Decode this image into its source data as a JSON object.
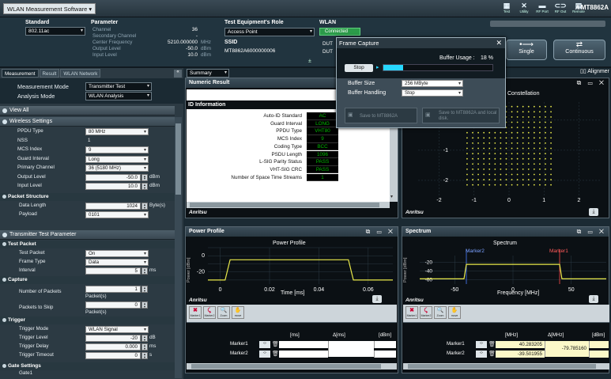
{
  "titlebar": {
    "app_name": "WLAN Measurement Software",
    "icons": [
      {
        "name": "test-icon",
        "label": "Test"
      },
      {
        "name": "utility-icon",
        "label": "Utility"
      },
      {
        "name": "rf-port-icon",
        "label": "RF Port"
      },
      {
        "name": "rf-out-icon",
        "label": "RF Out"
      },
      {
        "name": "remote-icon",
        "label": "Remote"
      }
    ],
    "brand": "MT8862A"
  },
  "top": {
    "standard_label": "Standard",
    "standard_value": "802.11ac",
    "parameter_label": "Parameter",
    "channel_label": "Channel",
    "channel_value": "36",
    "secondary_channel_label": "Secondary Channel",
    "secondary_channel_value": "-",
    "center_freq_label": "Center Frequency",
    "center_freq_value": "5210.000000",
    "center_freq_unit": "MHz",
    "output_level_label": "Output Level",
    "output_level_value": "-50.0",
    "output_level_unit": "dBm",
    "input_level_label": "Input Level",
    "input_level_value": "10.0",
    "input_level_unit": "dBm",
    "role_label": "Test Equipment's Role",
    "role_value": "Access Point",
    "ssid_label": "SSID",
    "ssid_value": "MT8862A6000000006",
    "wlan_label": "WLAN",
    "wlan_status": "Connected",
    "dut_label_1": "DUT",
    "dut_label_2": "DUT",
    "single_label": "Single",
    "continuous_label": "Continuous",
    "alignment_label": "Alignmer"
  },
  "left": {
    "tabs": [
      "Measurement",
      "Result",
      "WLAN Network"
    ],
    "measurement_mode_label": "Measurement Mode",
    "measurement_mode_value": "Transmitter Test",
    "analysis_mode_label": "Analysis Mode",
    "analysis_mode_value": "WLAN Analysis",
    "view_all": "View All",
    "wireless_settings": "Wireless Settings",
    "wireless_rows": [
      {
        "label": "PPDU Type",
        "value": "80 MHz",
        "type": "dd"
      },
      {
        "label": "NSS",
        "value": "1",
        "type": "text"
      },
      {
        "label": "MCS Index",
        "value": "9",
        "type": "dd"
      },
      {
        "label": "Guard Interval",
        "value": "Long",
        "type": "dd"
      },
      {
        "label": "Primary Channel",
        "value": "36 (5180 MHz)",
        "type": "dd"
      },
      {
        "label": "Output Level",
        "value": "-50.0",
        "unit": "dBm",
        "type": "num"
      },
      {
        "label": "Input Level",
        "value": "10.0",
        "unit": "dBm",
        "type": "num"
      }
    ],
    "packet_structure": "Packet Structure",
    "data_length_label": "Data Length",
    "data_length_value": "1024",
    "data_length_unit": "Byte(s)",
    "payload_label": "Payload",
    "payload_value": "0101",
    "tx_param": "Transmitter Test Parameter",
    "test_packet": "Test Packet",
    "test_packet_rows": [
      {
        "label": "Test Packet",
        "value": "On"
      },
      {
        "label": "Frame Type",
        "value": "Data"
      }
    ],
    "interval_label": "Interval",
    "interval_value": "5",
    "interval_unit": "ms",
    "capture": "Capture",
    "num_packets_label": "Number of Packets",
    "num_packets_value": "1",
    "num_packets_unit": "Packet(s)",
    "skip_label": "Packets to Skip",
    "skip_value": "0",
    "skip_unit": "Packet(s)",
    "trigger": "Trigger",
    "trigger_mode_label": "Trigger Mode",
    "trigger_mode_value": "WLAN Signal",
    "trigger_level_label": "Trigger Level",
    "trigger_level_value": "-20",
    "trigger_level_unit": "dB",
    "trigger_delay_label": "Trigger Delay",
    "trigger_delay_value": "0.000",
    "trigger_delay_unit": "ms",
    "trigger_timeout_label": "Trigger Timeout",
    "trigger_timeout_value": "0",
    "trigger_timeout_unit": "s",
    "gate_settings": "Gate Settings",
    "gate1": "Gate1"
  },
  "summary": {
    "label": "Summary"
  },
  "numeric": {
    "title": "Numeric Result",
    "section": "ID Information",
    "rows": [
      {
        "label": "Auto-ID Standard",
        "value": "AC"
      },
      {
        "label": "Guard Interval",
        "value": "LONG"
      },
      {
        "label": "PPDU Type",
        "value": "VHT80"
      },
      {
        "label": "MCS Index",
        "value": "9"
      },
      {
        "label": "Coding Type",
        "value": "BCC"
      },
      {
        "label": "PSDU Length",
        "value": "1096"
      },
      {
        "label": "L-SIG Parity Status",
        "value": "PASS"
      },
      {
        "label": "VHT-SIG CRC",
        "value": "PASS"
      },
      {
        "label": "Number of Space Time Streams",
        "value": "1"
      }
    ],
    "brand": "Anritsu"
  },
  "dialog": {
    "title": "Frame Capture",
    "stop_label": "Stop",
    "buffer_usage_label": "Buffer Usage :",
    "buffer_usage_value": "18 %",
    "buffer_fill": 0.18,
    "buffer_size_label": "Buffer Size",
    "buffer_size_value": "256 MByte",
    "buffer_handling_label": "Buffer Handling",
    "buffer_handling_value": "Stop",
    "save_to_label": "Save to MT8862A",
    "save_local_label": "Save to MT8862A and local disk."
  },
  "constellation": {
    "title": "Constellation",
    "brand": "Anritsu",
    "yticks": [
      "0",
      "-1",
      "-2"
    ],
    "xticks": [
      "-2",
      "-1",
      "0",
      "1",
      "2"
    ]
  },
  "power_profile": {
    "title": "Power Profile",
    "chart_title": "Power Profile",
    "ylabel": "Power [dBm]",
    "xlabel": "Time [ms]",
    "yticks": [
      "0",
      "-20"
    ],
    "xticks": [
      "0",
      "0.02",
      "0.04",
      "0.06"
    ],
    "brand": "Anritsu",
    "tools": [
      "Marker1",
      "Marker2",
      "Zoom",
      "move"
    ],
    "table_headers": [
      "[ms]",
      "Δ[ms]",
      "[dBm]"
    ],
    "markers": [
      "Marker1",
      "Marker2"
    ]
  },
  "spectrum": {
    "title": "Spectrum",
    "chart_title": "Spectrum",
    "ylabel": "Power [dBm]",
    "xlabel": "Frequency [MHz]",
    "yticks": [
      "-20",
      "-40",
      "-60"
    ],
    "xticks": [
      "-50",
      "0",
      "50"
    ],
    "marker2_label": "Marker2",
    "marker1_label": "Marker1",
    "brand": "Anritsu",
    "tools": [
      "Marker1",
      "Marker2",
      "Zoom",
      "move"
    ],
    "table_headers": [
      "[MHz]",
      "Δ[MHz]",
      "[dBm]"
    ],
    "markers": [
      {
        "name": "Marker1",
        "mhz": "40.283205"
      },
      {
        "name": "Marker2",
        "mhz": "-39.501955"
      }
    ],
    "delta": "-79.785160"
  },
  "chart_data": [
    {
      "type": "line",
      "title": "Power Profile",
      "xlabel": "Time [ms]",
      "ylabel": "Power [dBm]",
      "xlim": [
        -0.005,
        0.07
      ],
      "ylim": [
        -35,
        10
      ],
      "series": [
        {
          "x": [
            -0.005,
            0.002,
            0.004,
            0.052,
            0.054,
            0.07
          ],
          "y": [
            -30,
            -30,
            -5,
            -5,
            -30,
            -30
          ]
        }
      ]
    },
    {
      "type": "line",
      "title": "Spectrum",
      "xlabel": "Frequency [MHz]",
      "ylabel": "Power [dBm]",
      "xlim": [
        -80,
        80
      ],
      "ylim": [
        -70,
        -5
      ],
      "series": [
        {
          "x": [
            -80,
            -42,
            -40,
            40,
            42,
            80
          ],
          "y": [
            -58,
            -58,
            -25,
            -25,
            -58,
            -58
          ]
        }
      ]
    },
    {
      "type": "scatter",
      "title": "Constellation",
      "xlim": [
        -2.6,
        2.6
      ],
      "ylim": [
        -2.5,
        0.6
      ],
      "note": "256QAM"
    }
  ],
  "colors": {
    "bg": "#1b2a33",
    "accent": "#27d7ff",
    "connected": "#2c9b4a",
    "trace": "#e8e84a"
  }
}
